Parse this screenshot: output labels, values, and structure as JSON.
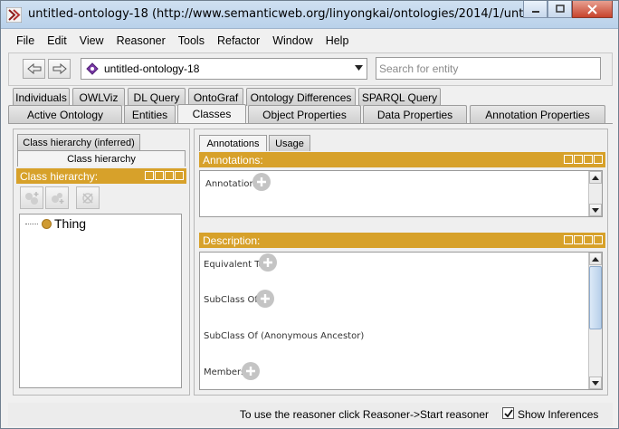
{
  "window": {
    "title": "untitled-ontology-18 (http://www.semanticweb.org/linyongkai/ontologies/2014/1/untitled-..."
  },
  "menu": [
    "File",
    "Edit",
    "View",
    "Reasoner",
    "Tools",
    "Refactor",
    "Window",
    "Help"
  ],
  "toolbar": {
    "ontology": "untitled-ontology-18",
    "search_placeholder": "Search for entity"
  },
  "tabs_top": [
    "Individuals",
    "OWLViz",
    "DL Query",
    "OntoGraf",
    "Ontology Differences",
    "SPARQL Query"
  ],
  "tabs_bottom": [
    "Active Ontology",
    "Entities",
    "Classes",
    "Object Properties",
    "Data Properties",
    "Annotation Properties"
  ],
  "active_tab": "Classes",
  "left": {
    "subtab_inferred": "Class hierarchy (inferred)",
    "subtab_asserted": "Class hierarchy",
    "view_title": "Class hierarchy:",
    "root_class": "Thing"
  },
  "right": {
    "tab_annotations": "Annotations",
    "tab_usage": "Usage",
    "annotations_header": "Annotations:",
    "annotations_label": "Annotations",
    "description_header": "Description:",
    "sections": [
      "Equivalent To",
      "SubClass Of",
      "SubClass Of (Anonymous Ancestor)",
      "Members"
    ]
  },
  "status": {
    "message": "To use the reasoner click Reasoner->Start reasoner",
    "show_inferences_label": "Show Inferences",
    "show_inferences_checked": true
  },
  "colors": {
    "view_header": "#d7a12a",
    "class_icon": "#cf9b33",
    "ontology_icon": "#7b3aa8"
  }
}
